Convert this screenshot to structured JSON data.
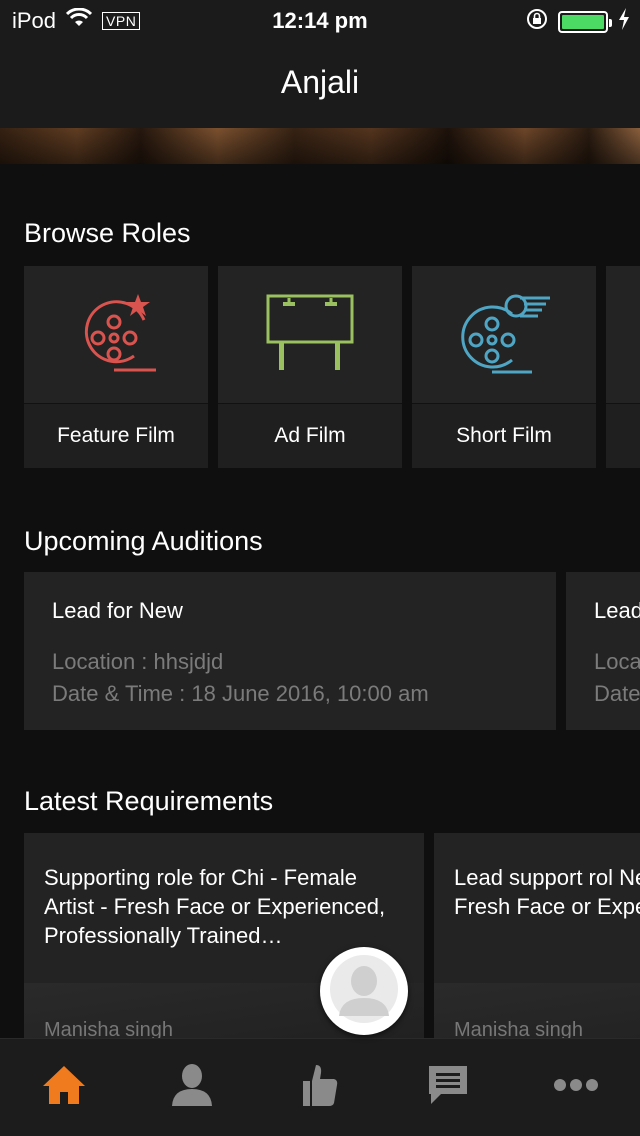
{
  "status_bar": {
    "carrier": "iPod",
    "vpn": "VPN",
    "time": "12:14 pm",
    "battery_color": "#4cd964"
  },
  "nav": {
    "title": "Anjali"
  },
  "browse_roles": {
    "title": "Browse Roles",
    "items": [
      {
        "label": "Feature Film",
        "icon": "film-reel-star-icon",
        "color": "#d9534f"
      },
      {
        "label": "Ad Film",
        "icon": "billboard-icon",
        "color": "#9ac060"
      },
      {
        "label": "Short Film",
        "icon": "film-reel-wind-icon",
        "color": "#4fa6c4"
      }
    ]
  },
  "upcoming_auditions": {
    "title": "Upcoming Auditions",
    "items": [
      {
        "title": "Lead for New",
        "location": "Location : hhsjdjd",
        "datetime": "Date & Time : 18 June 2016, 10:00 am"
      },
      {
        "title": "Lead",
        "location": "Loca",
        "datetime": "Date"
      }
    ]
  },
  "latest_requirements": {
    "title": "Latest Requirements",
    "items": [
      {
        "text": "Supporting role  for Chi - Female Artist  - Fresh Face or Experienced, Professionally Trained…",
        "author": "Manisha singh"
      },
      {
        "text": "Lead support rol New - Female Ar Fresh Face or Experienced, Pro",
        "author": "Manisha singh"
      }
    ]
  },
  "tab_bar": {
    "accent": "#f07b1e",
    "inactive": "#8a8a8a",
    "tabs": [
      {
        "icon": "home-icon",
        "active": true
      },
      {
        "icon": "profile-icon",
        "active": false
      },
      {
        "icon": "thumbs-up-icon",
        "active": false
      },
      {
        "icon": "messages-icon",
        "active": false
      },
      {
        "icon": "more-icon",
        "active": false
      }
    ]
  }
}
